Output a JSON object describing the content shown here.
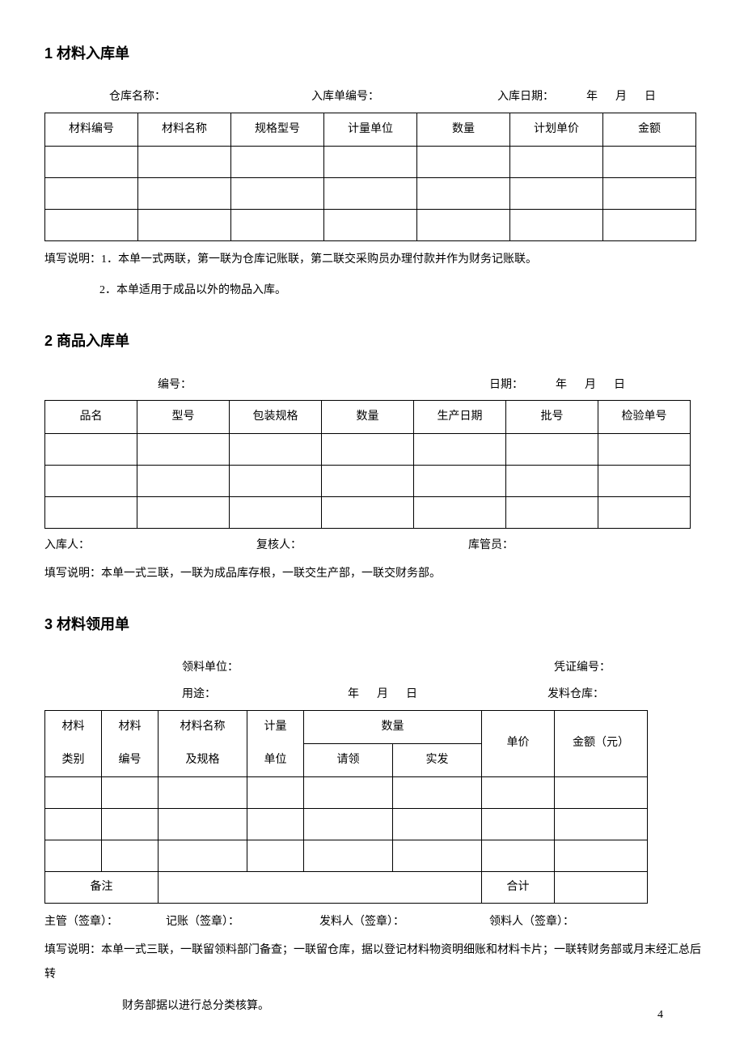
{
  "section1": {
    "title": "1   材料入库单",
    "meta": {
      "warehouse": "仓库名称：",
      "formNo": "入库单编号：",
      "date": "入库日期：",
      "year": "年",
      "month": "月",
      "day": "日"
    },
    "headers": [
      "材料编号",
      "材料名称",
      "规格型号",
      "计量单位",
      "数量",
      "计划单价",
      "金额"
    ],
    "note1": "填写说明：1．本单一式两联，第一联为仓库记账联，第二联交采购员办理付款并作为财务记账联。",
    "note2": "2．本单适用于成品以外的物品入库。"
  },
  "section2": {
    "title": "2   商品入库单",
    "meta": {
      "formNo": "编号：",
      "date": "日期：",
      "year": "年",
      "month": "月",
      "day": "日"
    },
    "headers": [
      "品名",
      "型号",
      "包装规格",
      "数量",
      "生产日期",
      "批号",
      "检验单号"
    ],
    "sign": {
      "a": "入库人：",
      "b": "复核人：",
      "c": "库管员："
    },
    "note": "填写说明：本单一式三联，一联为成品库存根，一联交生产部，一联交财务部。"
  },
  "section3": {
    "title": "3  材料领用单",
    "meta": {
      "unit": "领料单位：",
      "voucher": "凭证编号：",
      "usage": "用途：",
      "year": "年",
      "month": "月",
      "day": "日",
      "warehouse": "发料仓库："
    },
    "headers": {
      "c1": "材料",
      "c1b": "类别",
      "c2": "材料",
      "c2b": "编号",
      "c3": "材料名称",
      "c3b": "及规格",
      "c4": "计量",
      "c4b": "单位",
      "c5": "数量",
      "c5a": "请领",
      "c5b": "实发",
      "c6": "单价",
      "c7": "金额（元）"
    },
    "remark": "备注",
    "total": "合计",
    "sign": {
      "a": "主管（签章）：",
      "b": "记账（签章）：",
      "c": "发料人（签章）：",
      "d": "领料人（签章）："
    },
    "note": "填写说明：本单一式三联，一联留领料部门备查；一联留仓库，据以登记材料物资明细账和材料卡片；一联转财务部或月末经汇总后转",
    "note2": "财务部据以进行总分类核算。"
  },
  "pageNumber": "4"
}
